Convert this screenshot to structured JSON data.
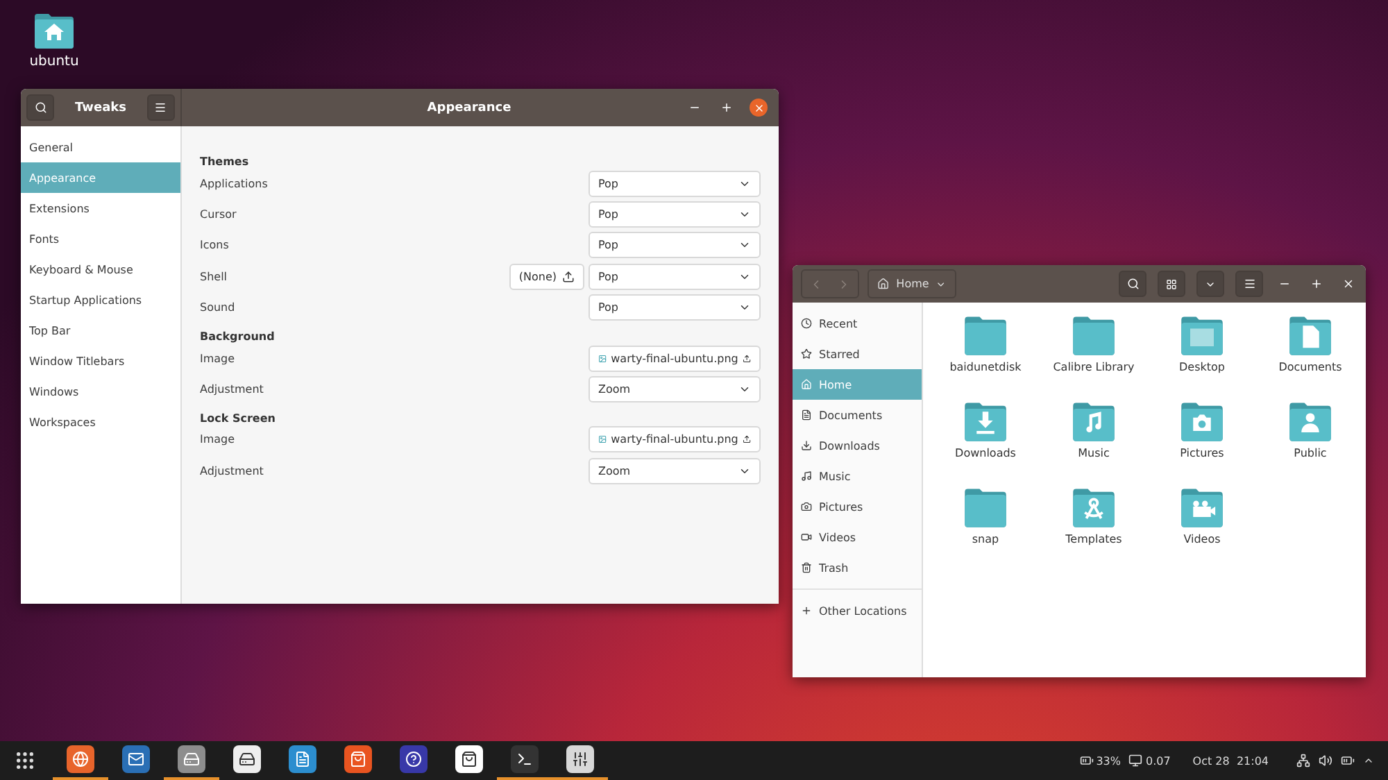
{
  "desktop_icon": {
    "label": "ubuntu"
  },
  "tweaks": {
    "sidebar_title": "Tweaks",
    "title": "Appearance",
    "sidebar": [
      {
        "label": "General",
        "selected": false
      },
      {
        "label": "Appearance",
        "selected": true
      },
      {
        "label": "Extensions",
        "selected": false
      },
      {
        "label": "Fonts",
        "selected": false
      },
      {
        "label": "Keyboard & Mouse",
        "selected": false
      },
      {
        "label": "Startup Applications",
        "selected": false
      },
      {
        "label": "Top Bar",
        "selected": false
      },
      {
        "label": "Window Titlebars",
        "selected": false
      },
      {
        "label": "Windows",
        "selected": false
      },
      {
        "label": "Workspaces",
        "selected": false
      }
    ],
    "sections": [
      {
        "title": "Themes",
        "rows": [
          {
            "label": "Applications",
            "kind": "combo",
            "value": "Pop"
          },
          {
            "label": "Cursor",
            "kind": "combo",
            "value": "Pop"
          },
          {
            "label": "Icons",
            "kind": "combo",
            "value": "Pop"
          },
          {
            "label": "Shell",
            "kind": "combo",
            "value": "Pop",
            "extra": "(None)"
          },
          {
            "label": "Sound",
            "kind": "combo",
            "value": "Pop"
          }
        ]
      },
      {
        "title": "Background",
        "rows": [
          {
            "label": "Image",
            "kind": "file",
            "value": "warty-final-ubuntu.png"
          },
          {
            "label": "Adjustment",
            "kind": "combo",
            "value": "Zoom"
          }
        ]
      },
      {
        "title": "Lock Screen",
        "rows": [
          {
            "label": "Image",
            "kind": "file",
            "value": "warty-final-ubuntu.png"
          },
          {
            "label": "Adjustment",
            "kind": "combo",
            "value": "Zoom"
          }
        ]
      }
    ]
  },
  "files": {
    "path": "Home",
    "places": [
      {
        "label": "Recent",
        "kind": "recent",
        "selected": false
      },
      {
        "label": "Starred",
        "kind": "star",
        "selected": false
      },
      {
        "label": "Home",
        "kind": "home",
        "selected": true
      },
      {
        "label": "Documents",
        "kind": "doc",
        "selected": false
      },
      {
        "label": "Downloads",
        "kind": "download",
        "selected": false
      },
      {
        "label": "Music",
        "kind": "music",
        "selected": false
      },
      {
        "label": "Pictures",
        "kind": "camera",
        "selected": false
      },
      {
        "label": "Videos",
        "kind": "video",
        "selected": false
      },
      {
        "label": "Trash",
        "kind": "trash",
        "selected": false
      }
    ],
    "other_locations": "Other Locations",
    "items": [
      {
        "label": "baidunetdisk",
        "kind": "folder"
      },
      {
        "label": "Calibre Library",
        "kind": "folder"
      },
      {
        "label": "Desktop",
        "kind": "desktop"
      },
      {
        "label": "Documents",
        "kind": "doc"
      },
      {
        "label": "Downloads",
        "kind": "download"
      },
      {
        "label": "Music",
        "kind": "music"
      },
      {
        "label": "Pictures",
        "kind": "camera"
      },
      {
        "label": "Public",
        "kind": "person"
      },
      {
        "label": "snap",
        "kind": "folder"
      },
      {
        "label": "Templates",
        "kind": "template"
      },
      {
        "label": "Videos",
        "kind": "video"
      }
    ]
  },
  "dock": [
    {
      "kind": "firefox",
      "running": true
    },
    {
      "kind": "mail",
      "running": false
    },
    {
      "kind": "files",
      "running": true
    },
    {
      "kind": "disk",
      "running": false
    },
    {
      "kind": "writer",
      "running": false
    },
    {
      "kind": "store",
      "running": false
    },
    {
      "kind": "help",
      "running": false
    },
    {
      "kind": "amazon",
      "running": false
    },
    {
      "kind": "terminal",
      "running": true
    },
    {
      "kind": "tweaks",
      "running": true
    }
  ],
  "status": {
    "battery_text": "33%",
    "load": "0.07",
    "clock": "Oct 28  21:04"
  }
}
